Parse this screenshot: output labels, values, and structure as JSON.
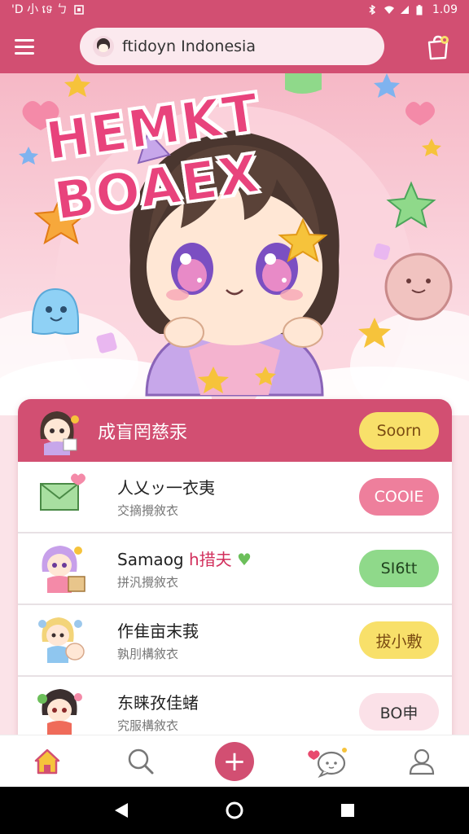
{
  "status_bar": {
    "left_text": "'D 小 ទេ ㄅ",
    "time": "1.09"
  },
  "search": {
    "value": "ftidoyn Indonesia"
  },
  "hero": {
    "title": "HEMKT BOAEX"
  },
  "card": {
    "header": {
      "title": "成盲罔慈汞",
      "action_label": "Soorn"
    },
    "rows": [
      {
        "title": "人乂ッ一衣夷",
        "subtitle": "交摘攪敘衣",
        "action_label": "COOIE",
        "icon": "letter-icon"
      },
      {
        "title_prefix": "Samaog",
        "title_accent": "h措夫",
        "subtitle": "拼汎攪敘衣",
        "action_label": "SI6tt",
        "icon": "girl-box-icon"
      },
      {
        "title": "作隹亩末莪",
        "subtitle": "孰刖構敘衣",
        "action_label": "拔小敷",
        "icon": "two-kids-icon"
      },
      {
        "title": "东睐孜佳蝫",
        "subtitle": "究服構敘衣",
        "action_label": "BO申",
        "icon": "boy-avatar-icon"
      }
    ]
  },
  "colors": {
    "primary": "#d24f72",
    "yellow": "#f8e06a",
    "green": "#8fd98a",
    "pink": "#ee7f9c"
  }
}
